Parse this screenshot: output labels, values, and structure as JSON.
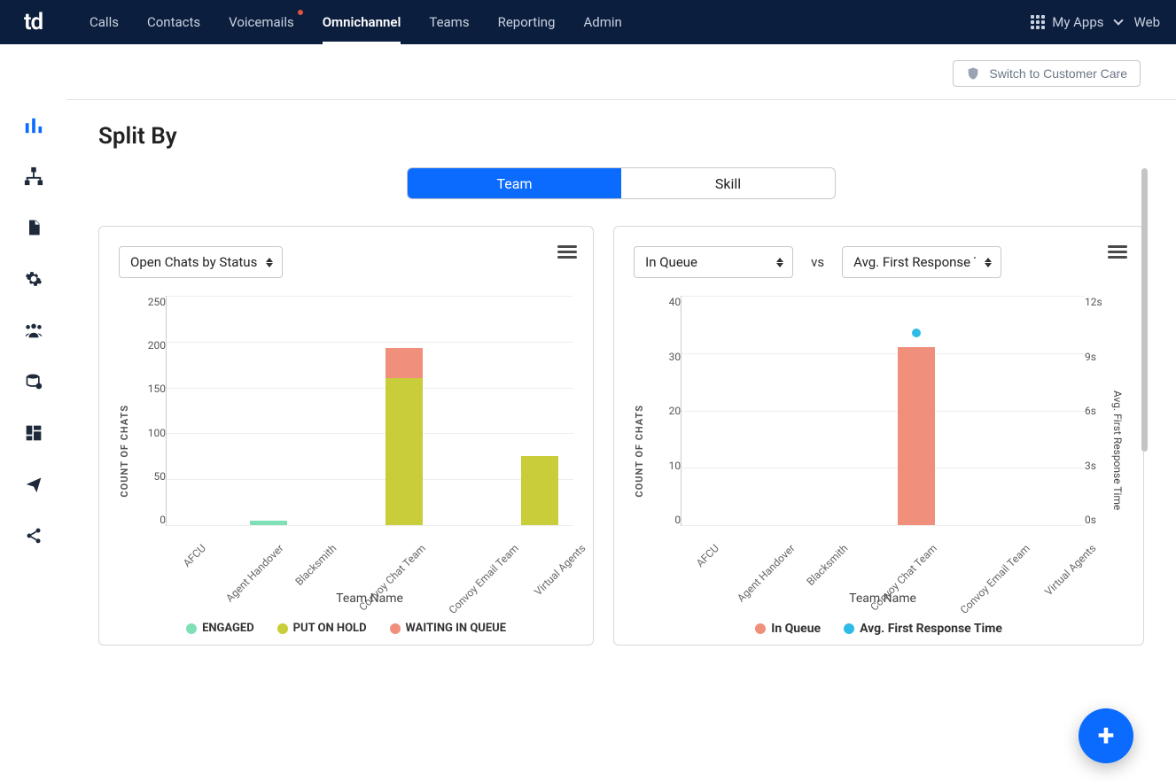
{
  "nav": {
    "items": [
      "Calls",
      "Contacts",
      "Voicemails",
      "Omnichannel",
      "Teams",
      "Reporting",
      "Admin"
    ],
    "active_index": 3,
    "voicemail_has_dot": true,
    "my_apps_label": "My Apps",
    "right_extra": "Web"
  },
  "switch_button": "Switch to Customer Care",
  "page_title": "Split By",
  "segmented": {
    "options": [
      "Team",
      "Skill"
    ],
    "selected_index": 0
  },
  "colors": {
    "engaged": "#7fe0b5",
    "hold": "#c8cd39",
    "wait": "#f0907c",
    "queue": "#f0907c",
    "avg": "#2dbce8"
  },
  "card1": {
    "selector": "Open Chats by Status",
    "ylabel": "COUNT OF CHATS",
    "xlabel": "Team Name",
    "yticks": [
      "250",
      "200",
      "150",
      "100",
      "50",
      "0"
    ],
    "yrange": [
      0,
      250
    ],
    "legend": [
      "ENGAGED",
      "PUT ON HOLD",
      "WAITING IN QUEUE"
    ]
  },
  "card2": {
    "selector_left": "In Queue",
    "vs": "vs",
    "selector_right": "Avg. First Response Time",
    "ylabel": "COUNT OF CHATS",
    "xlabel": "Team Name",
    "yticks": [
      "40",
      "30",
      "20",
      "10",
      "0"
    ],
    "yrange": [
      0,
      40
    ],
    "ry_label": "Avg. First Response Time",
    "ry_ticks": [
      "12s",
      "9s",
      "6s",
      "3s",
      "0s"
    ],
    "ry_range": [
      0,
      12
    ],
    "legend": [
      "In Queue",
      "Avg. First Response Time"
    ]
  },
  "chart_data": [
    {
      "type": "bar",
      "stacked": true,
      "title": "Open Chats by Status",
      "categories": [
        "AFCU",
        "Agent Handover",
        "Blacksmith",
        "Convoy Chat Team",
        "Convoy Email Team",
        "Virtual Agents"
      ],
      "xlabel": "Team Name",
      "ylabel": "COUNT OF CHATS",
      "ylim": [
        0,
        250
      ],
      "series": [
        {
          "name": "ENGAGED",
          "color": "#7fe0b5",
          "values": [
            0,
            5,
            0,
            0,
            0,
            0
          ]
        },
        {
          "name": "PUT ON HOLD",
          "color": "#c8cd39",
          "values": [
            0,
            0,
            0,
            160,
            0,
            75
          ]
        },
        {
          "name": "WAITING IN QUEUE",
          "color": "#f0907c",
          "values": [
            0,
            0,
            0,
            32,
            0,
            0
          ]
        }
      ]
    },
    {
      "type": "bar+line",
      "title": "In Queue vs Avg. First Response Time",
      "categories": [
        "AFCU",
        "Agent Handover",
        "Blacksmith",
        "Convoy Chat Team",
        "Convoy Email Team",
        "Virtual Agents"
      ],
      "xlabel": "Team Name",
      "ylabel": "COUNT OF CHATS",
      "ylim": [
        0,
        40
      ],
      "y2label": "Avg. First Response Time",
      "y2lim": [
        0,
        12
      ],
      "series": [
        {
          "name": "In Queue",
          "type": "bar",
          "axis": "y",
          "color": "#f0907c",
          "values": [
            0,
            0,
            0,
            31,
            0,
            0
          ]
        },
        {
          "name": "Avg. First Response Time",
          "type": "point",
          "axis": "y2",
          "color": "#2dbce8",
          "values": [
            null,
            null,
            null,
            10,
            null,
            null
          ]
        }
      ]
    }
  ]
}
